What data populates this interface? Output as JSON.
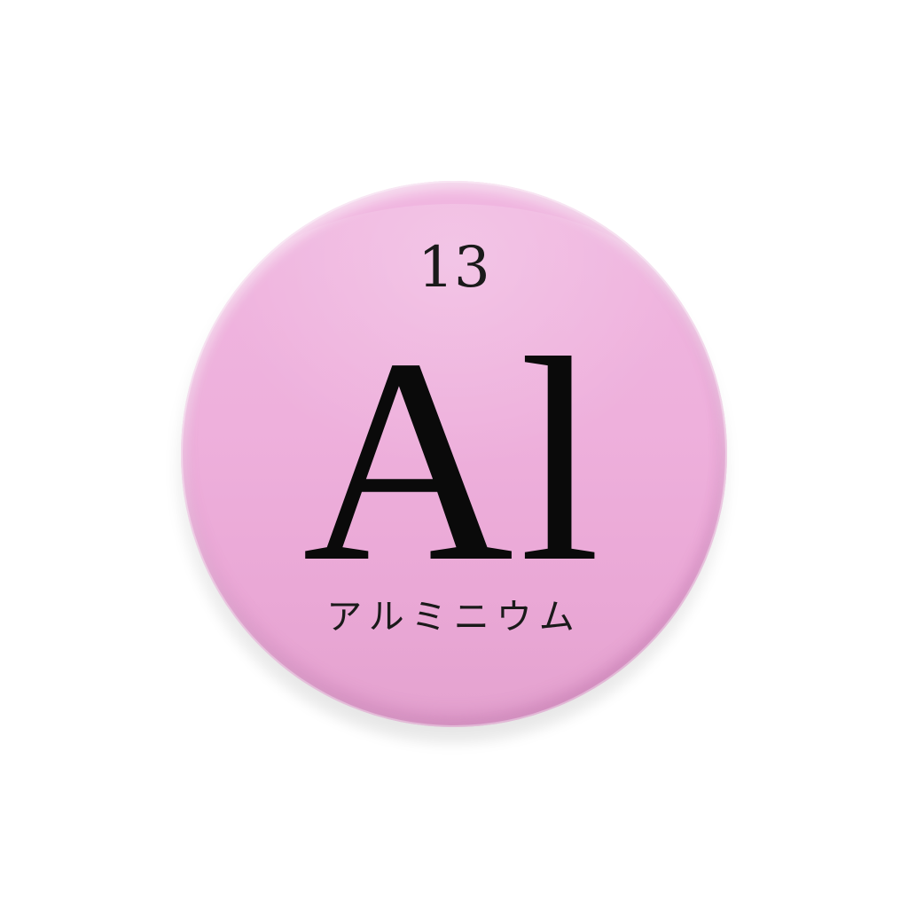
{
  "badge": {
    "atomic_number": "13",
    "symbol": "Al",
    "name": "アルミニウム",
    "color": "#eeb0dc"
  }
}
